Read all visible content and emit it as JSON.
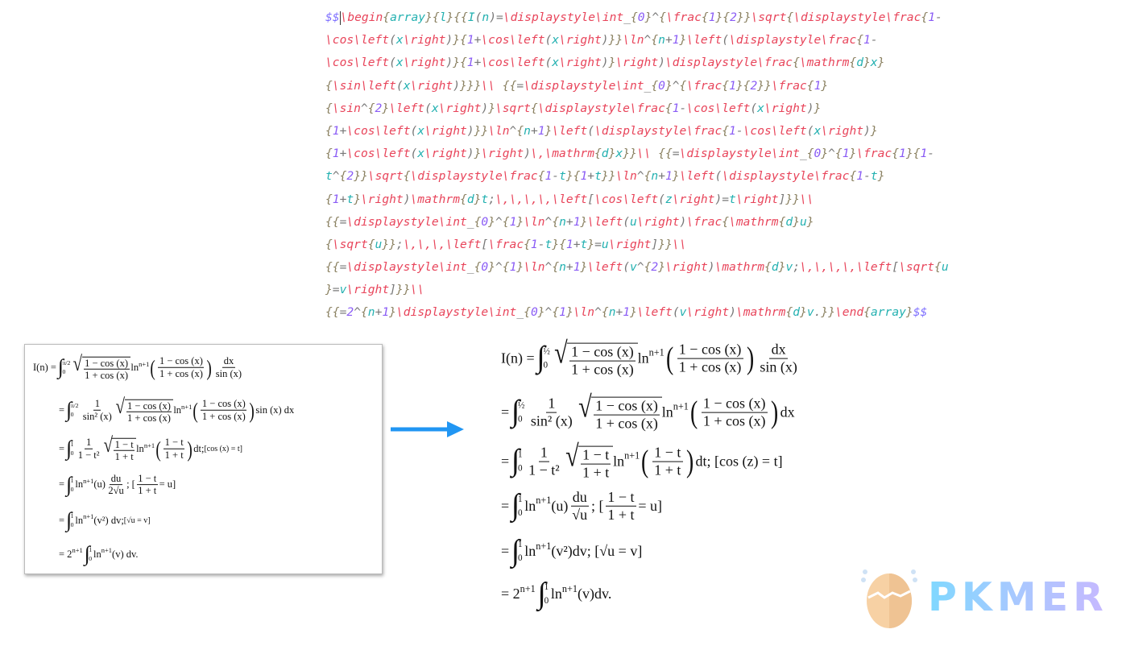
{
  "code_lines": [
    "$$\\begin{array}{l}{{I(n)=\\displaystyle\\int_{0}^{\\frac{1}{2}}\\sqrt{\\displaystyle\\frac{1-",
    "\\cos\\left(x\\right)}{1+\\cos\\left(x\\right)}}\\ln^{n+1}\\left(\\displaystyle\\frac{1-",
    "\\cos\\left(x\\right)}{1+\\cos\\left(x\\right)}\\right)\\displaystyle\\frac{\\mathrm{d}x}",
    "{\\sin\\left(x\\right)}}}\\\\ {{=\\displaystyle\\int_{0}^{\\frac{1}{2}}\\frac{1}",
    "{\\sin^{2}\\left(x\\right)}\\sqrt{\\displaystyle\\frac{1-\\cos\\left(x\\right)}",
    "{1+\\cos\\left(x\\right)}}\\ln^{n+1}\\left(\\displaystyle\\frac{1-\\cos\\left(x\\right)}",
    "{1+\\cos\\left(x\\right)}\\right)\\,\\mathrm{d}x}}\\\\ {{=\\displaystyle\\int_{0}^{1}\\frac{1}{1-",
    "t^{2}}\\sqrt{\\displaystyle\\frac{1-t}{1+t}}\\ln^{n+1}\\left(\\displaystyle\\frac{1-t}",
    "{1+t}\\right)\\mathrm{d}t;\\,\\,\\,\\,\\left[\\cos\\left(z\\right)=t\\right]}}\\\\",
    "{{=\\displaystyle\\int_{0}^{1}\\ln^{n+1}\\left(u\\right)\\frac{\\mathrm{d}u}",
    "{\\sqrt{u}};\\,\\,\\,\\left[\\frac{1-t}{1+t}=u\\right]}}\\\\",
    "{{=\\displaystyle\\int_{0}^{1}\\ln^{n+1}\\left(v^{2}\\right)\\mathrm{d}v;\\,\\,\\,\\,\\left[\\sqrt{u",
    "}=v\\right]}}\\\\",
    "{{=2^{n+1}\\displaystyle\\int_{0}^{1}\\ln^{n+1}\\left(v\\right)\\mathrm{d}v.}}\\end{array}$$"
  ],
  "syntax_colors": {
    "command": "#e8445a",
    "number": "#8a5cf5",
    "brace": "#8a8060",
    "variable": "#22b0b0",
    "delimiter": "#7b6cff"
  },
  "arrow_color": "#2196f3",
  "left_image_lines": [
    [
      {
        "t": "I(n) = "
      },
      {
        "int": [
          "0",
          "π/2"
        ]
      },
      {
        "sqrtfrac": [
          "1 − cos (x)",
          "1 + cos (x)"
        ]
      },
      {
        "t": " ln"
      },
      {
        "sup": "n+1"
      },
      {
        "pfrac": [
          "1 − cos (x)",
          "1 + cos (x)"
        ]
      },
      {
        "frac": [
          "dx",
          "sin (x)"
        ]
      }
    ],
    [
      {
        "t": "= "
      },
      {
        "int": [
          "0",
          "π/2"
        ]
      },
      {
        "frac": [
          "1",
          "sin² (x)"
        ]
      },
      {
        "sqrtfrac": [
          "1 − cos (x)",
          "1 + cos (x)"
        ]
      },
      {
        "t": " ln"
      },
      {
        "sup": "n+1"
      },
      {
        "pfrac": [
          "1 − cos (x)",
          "1 + cos (x)"
        ]
      },
      {
        "t": " sin (x) dx"
      }
    ],
    [
      {
        "t": "= "
      },
      {
        "int": [
          "0",
          "1"
        ]
      },
      {
        "frac": [
          "1",
          "1 − t²"
        ]
      },
      {
        "sqrtfrac": [
          "1 − t",
          "1 + t"
        ]
      },
      {
        "t": " ln"
      },
      {
        "sup": "n+1"
      },
      {
        "pfrac": [
          "1 − t",
          "1 + t"
        ]
      },
      {
        "t": " dt;   "
      },
      {
        "small": "[cos (x) = t]"
      }
    ],
    [
      {
        "t": "= "
      },
      {
        "int": [
          "0",
          "1"
        ]
      },
      {
        "t": " ln"
      },
      {
        "sup": "n+1"
      },
      {
        "t": " (u) "
      },
      {
        "frac": [
          "du",
          "2√u"
        ]
      },
      {
        "t": ";   ["
      },
      {
        "frac": [
          "1 − t",
          "1 + t"
        ]
      },
      {
        "t": " = u]"
      }
    ],
    [
      {
        "t": "= "
      },
      {
        "int": [
          "0",
          "1"
        ]
      },
      {
        "t": " ln"
      },
      {
        "sup": "n+1"
      },
      {
        "t": " (v²) dv;   "
      },
      {
        "small": "[√u = v]"
      }
    ],
    [
      {
        "t": "= 2"
      },
      {
        "sup": "n+1"
      },
      {
        "int": [
          "0",
          "1"
        ]
      },
      {
        "t": " ln"
      },
      {
        "sup": "n+1"
      },
      {
        "t": " (v) dv."
      }
    ]
  ],
  "rendered_lines": [
    [
      {
        "t": "I(n) = "
      },
      {
        "int": [
          "0",
          "½"
        ]
      },
      {
        "sqrtfrac": [
          "1 − cos (x)",
          "1 + cos (x)"
        ]
      },
      {
        "t": " ln"
      },
      {
        "sup": "n+1"
      },
      {
        "pfrac": [
          "1 − cos (x)",
          "1 + cos (x)"
        ]
      },
      {
        "frac": [
          "dx",
          "sin (x)"
        ]
      }
    ],
    [
      {
        "t": "= "
      },
      {
        "int": [
          "0",
          "½"
        ]
      },
      {
        "frac": [
          "1",
          "sin² (x)"
        ]
      },
      {
        "sqrtfrac": [
          "1 − cos (x)",
          "1 + cos (x)"
        ]
      },
      {
        "t": " ln"
      },
      {
        "sup": "n+1"
      },
      {
        "pfrac": [
          "1 − cos (x)",
          "1 + cos (x)"
        ]
      },
      {
        "t": " dx"
      }
    ],
    [
      {
        "t": "= "
      },
      {
        "int": [
          "0",
          "1"
        ]
      },
      {
        "frac": [
          "1",
          "1 − t²"
        ]
      },
      {
        "sqrtfrac": [
          "1 − t",
          "1 + t"
        ]
      },
      {
        "t": " ln"
      },
      {
        "sup": "n+1"
      },
      {
        "pfrac": [
          "1 − t",
          "1 + t"
        ]
      },
      {
        "t": "dt;   [cos (z) = t]"
      }
    ],
    [
      {
        "t": "= "
      },
      {
        "int": [
          "0",
          "1"
        ]
      },
      {
        "t": " ln"
      },
      {
        "sup": "n+1"
      },
      {
        "t": " (u)"
      },
      {
        "frac": [
          "du",
          "√u"
        ]
      },
      {
        "t": ";   ["
      },
      {
        "frac": [
          "1 − t",
          "1 + t"
        ]
      },
      {
        "t": " = u]"
      }
    ],
    [
      {
        "t": "= "
      },
      {
        "int": [
          "0",
          "1"
        ]
      },
      {
        "t": " ln"
      },
      {
        "sup": "n+1"
      },
      {
        "t": " (v²)dv;   [√u = v]"
      }
    ],
    [
      {
        "t": "= 2"
      },
      {
        "sup": "n+1"
      },
      {
        "int": [
          "0",
          "1"
        ]
      },
      {
        "t": " ln"
      },
      {
        "sup": "n+1"
      },
      {
        "t": " (v)dv."
      }
    ]
  ],
  "logo": {
    "text": "PKMER"
  }
}
